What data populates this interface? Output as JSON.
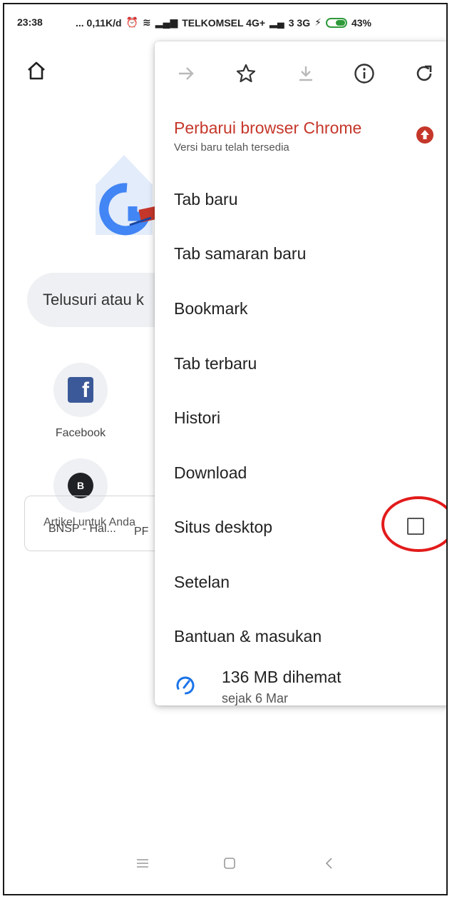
{
  "status_bar": {
    "time": "23:38",
    "network_speed": "... 0,11K/d",
    "carrier": "TELKOMSEL 4G+",
    "secondary_network": "3 3G",
    "battery": "43%"
  },
  "background_page": {
    "search_placeholder": "Telusuri atau k",
    "tiles": [
      {
        "label": "Facebook",
        "icon": "facebook-icon",
        "glyph": "f"
      },
      {
        "label": "BNSP - Hal...",
        "icon": "letter-b-icon",
        "glyph": "B"
      }
    ],
    "partial_tile_label": "PF",
    "articles_label": "Artikel untuk Anda"
  },
  "menu": {
    "toolbar": {
      "icons": [
        "forward-arrow-icon",
        "star-icon",
        "download-icon",
        "info-icon",
        "refresh-icon"
      ]
    },
    "update": {
      "title": "Perbarui browser Chrome",
      "subtitle": "Versi baru telah tersedia",
      "badge_icon": "update-arrow-icon"
    },
    "items": [
      {
        "label": "Tab baru"
      },
      {
        "label": "Tab samaran baru"
      },
      {
        "label": "Bookmark"
      },
      {
        "label": "Tab terbaru"
      },
      {
        "label": "Histori"
      },
      {
        "label": "Download"
      },
      {
        "label": "Situs desktop"
      },
      {
        "label": "Setelan"
      },
      {
        "label": "Bantuan & masukan"
      }
    ],
    "desktop_site_checked": false,
    "data_saver": {
      "title": "136 MB dihemat",
      "subtitle": "sejak 6 Mar"
    }
  },
  "colors": {
    "update_red": "#c5372a",
    "highlight_red": "#e21b1b",
    "facebook_blue": "#3b5998",
    "saver_blue": "#1a73e8"
  }
}
